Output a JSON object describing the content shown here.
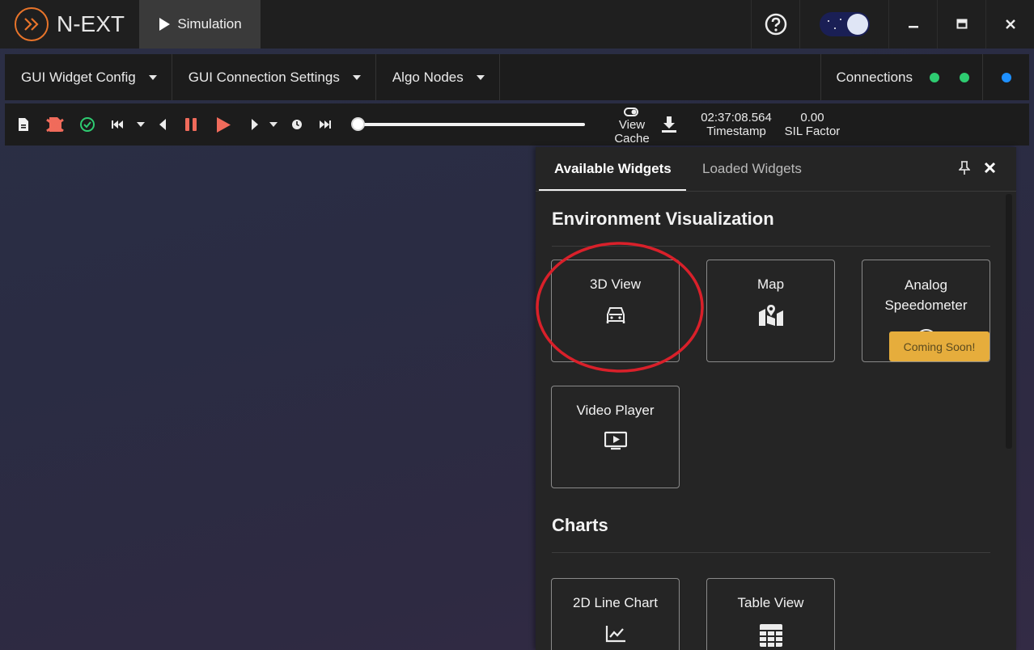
{
  "app": {
    "logo_text": "N-EXT",
    "active_tab": "Simulation"
  },
  "menubar": {
    "items": [
      {
        "label": "GUI Widget Config"
      },
      {
        "label": "GUI Connection Settings"
      },
      {
        "label": "Algo Nodes"
      }
    ],
    "connections_label": "Connections",
    "connection_dots": [
      "#2ecc71",
      "#2ecc71",
      "#1e90ff"
    ]
  },
  "controls": {
    "view_cache_line1": "View",
    "view_cache_line2": "Cache",
    "timestamp_value": "02:37:08.564",
    "timestamp_label": "Timestamp",
    "sil_value": "0.00",
    "sil_label": "SIL Factor",
    "progress": 0
  },
  "panel": {
    "tabs": [
      "Available Widgets",
      "Loaded Widgets"
    ],
    "sections": [
      {
        "title": "Environment Visualization",
        "widgets": [
          {
            "title": "3D View",
            "icon": "car-icon"
          },
          {
            "title": "Map",
            "icon": "map-icon"
          },
          {
            "title_line1": "Analog",
            "title_line2": "Speedometer",
            "icon": "speedometer-icon",
            "badge": "Coming Soon!"
          },
          {
            "title": "Video Player",
            "icon": "video-player-icon"
          }
        ]
      },
      {
        "title": "Charts",
        "widgets": [
          {
            "title": "2D Line Chart",
            "icon": "line-chart-icon"
          },
          {
            "title": "Table View",
            "icon": "table-icon"
          }
        ]
      }
    ]
  },
  "colors": {
    "accent_orange": "#e8742a",
    "coming_soon_badge": "#e6ad3c",
    "annotation_red": "#d9202a",
    "play_red": "#f06b5b",
    "check_green": "#2ecc71"
  }
}
